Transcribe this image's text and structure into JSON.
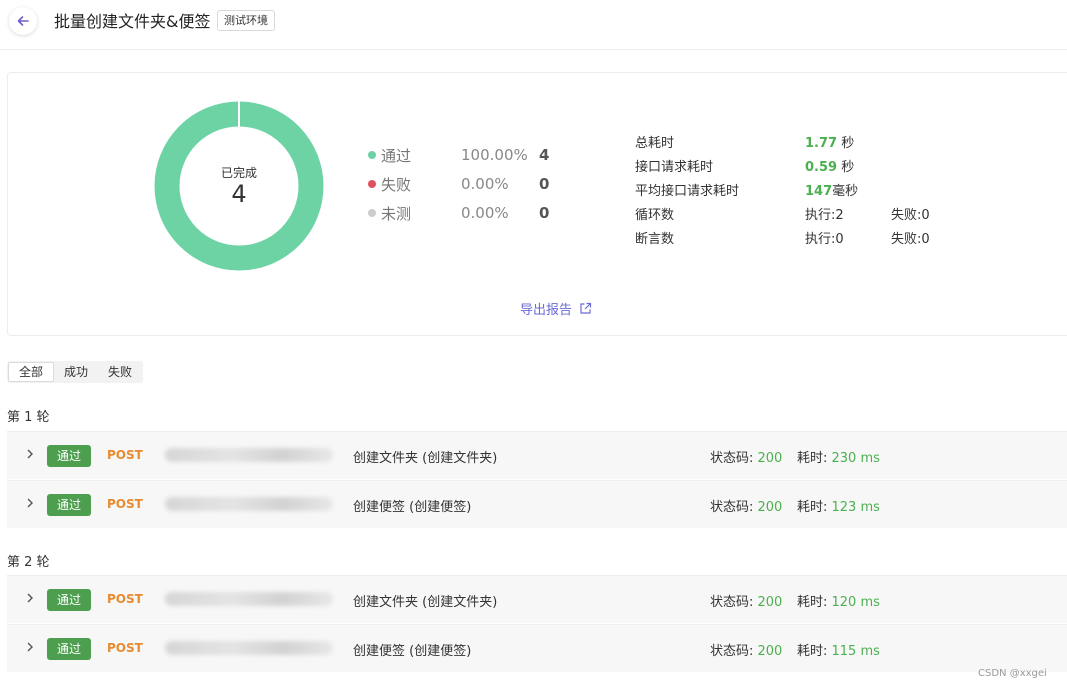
{
  "header": {
    "title": "批量创建文件夹&便签",
    "env_tag": "测试环境"
  },
  "summary": {
    "donut_label": "已完成",
    "donut_count": "4",
    "colors": {
      "pass": "#6dd3a5",
      "fail": "#e0505d",
      "untested": "#cccccc"
    },
    "legend": [
      {
        "name": "通过",
        "pct": "100.00%",
        "num": "4",
        "color": "#6dd3a5"
      },
      {
        "name": "失败",
        "pct": "0.00%",
        "num": "0",
        "color": "#e0505d"
      },
      {
        "name": "未测",
        "pct": "0.00%",
        "num": "0",
        "color": "#cccccc"
      }
    ],
    "stats": {
      "total_time_label": "总耗时",
      "total_time_value": "1.77",
      "total_time_unit": " 秒",
      "api_time_label": "接口请求耗时",
      "api_time_value": "0.59",
      "api_time_unit": " 秒",
      "avg_time_label": "平均接口请求耗时",
      "avg_time_value": "147",
      "avg_time_unit": "毫秒",
      "loop_label": "循环数",
      "loop_exec": "执行:2",
      "loop_fail": "失败:0",
      "assert_label": "断言数",
      "assert_exec": "执行:0",
      "assert_fail": "失败:0"
    },
    "export_label": "导出报告"
  },
  "tabs": [
    "全部",
    "成功",
    "失败"
  ],
  "rounds": [
    {
      "title": "第 1 轮",
      "rows": [
        {
          "badge": "通过",
          "method": "POST",
          "name": "创建文件夹 (创建文件夹)",
          "status_label": "状态码: ",
          "status_code": "200",
          "duration_label": "耗时: ",
          "duration": "230 ms"
        },
        {
          "badge": "通过",
          "method": "POST",
          "name": "创建便签 (创建便签)",
          "status_label": "状态码: ",
          "status_code": "200",
          "duration_label": "耗时: ",
          "duration": "123 ms"
        }
      ]
    },
    {
      "title": "第 2 轮",
      "rows": [
        {
          "badge": "通过",
          "method": "POST",
          "name": "创建文件夹 (创建文件夹)",
          "status_label": "状态码: ",
          "status_code": "200",
          "duration_label": "耗时: ",
          "duration": "120 ms"
        },
        {
          "badge": "通过",
          "method": "POST",
          "name": "创建便签 (创建便签)",
          "status_label": "状态码: ",
          "status_code": "200",
          "duration_label": "耗时: ",
          "duration": "115 ms"
        }
      ]
    }
  ],
  "watermark": "CSDN @xxgei"
}
